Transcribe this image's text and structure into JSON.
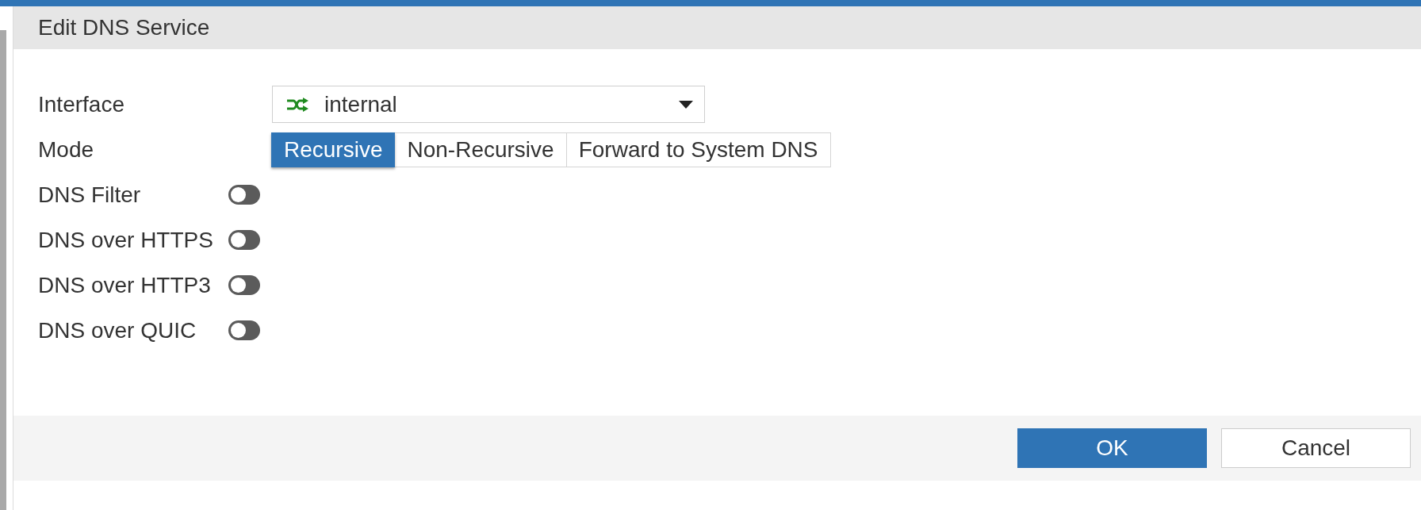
{
  "dialog": {
    "title": "Edit DNS Service"
  },
  "fields": [
    {
      "kind": "dropdown",
      "label": "Interface",
      "value": "internal"
    },
    {
      "kind": "segmented",
      "label": "Mode",
      "options": [
        {
          "label": "Recursive",
          "selected": true
        },
        {
          "label": "Non-Recursive",
          "selected": false
        },
        {
          "label": "Forward to System DNS",
          "selected": false
        }
      ]
    },
    {
      "kind": "toggle",
      "label": "DNS Filter",
      "on": false
    },
    {
      "kind": "toggle",
      "label": "DNS over HTTPS",
      "on": false
    },
    {
      "kind": "toggle",
      "label": "DNS over HTTP3",
      "on": false
    },
    {
      "kind": "toggle",
      "label": "DNS over QUIC",
      "on": false
    }
  ],
  "buttons": [
    {
      "kind": "primary",
      "label": "OK"
    },
    {
      "kind": "secondary",
      "label": "Cancel"
    }
  ]
}
